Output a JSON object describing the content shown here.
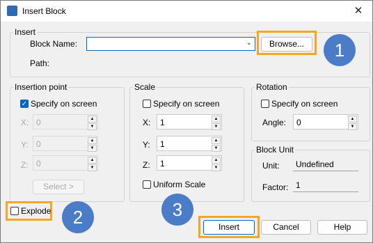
{
  "window": {
    "title": "Insert Block",
    "close_icon": "close-icon"
  },
  "insert": {
    "legend": "Insert",
    "block_name_label": "Block Name:",
    "block_name_value": "",
    "browse_label": "Browse...",
    "path_label": "Path:"
  },
  "insertion_point": {
    "legend": "Insertion point",
    "specify_label": "Specify on screen",
    "specify_checked": true,
    "x_label": "X:",
    "x_value": "0",
    "y_label": "Y:",
    "y_value": "0",
    "z_label": "Z:",
    "z_value": "0",
    "select_label": "Select >"
  },
  "scale": {
    "legend": "Scale",
    "specify_label": "Specify on screen",
    "specify_checked": false,
    "x_label": "X:",
    "x_value": "1",
    "y_label": "Y:",
    "y_value": "1",
    "z_label": "Z:",
    "z_value": "1",
    "uniform_label": "Uniform Scale",
    "uniform_checked": false
  },
  "rotation": {
    "legend": "Rotation",
    "specify_label": "Specify on screen",
    "specify_checked": false,
    "angle_label": "Angle:",
    "angle_value": "0"
  },
  "block_unit": {
    "legend": "Block Unit",
    "unit_label": "Unit:",
    "unit_value": "Undefined",
    "factor_label": "Factor:",
    "factor_value": "1"
  },
  "explode": {
    "label": "Explode",
    "checked": false
  },
  "footer": {
    "insert_label": "Insert",
    "cancel_label": "Cancel",
    "help_label": "Help"
  },
  "callouts": {
    "one": "1",
    "two": "2",
    "three": "3"
  },
  "colors": {
    "highlight": "#f5a623",
    "badge": "#4a7cc7",
    "accent": "#0067c0"
  }
}
